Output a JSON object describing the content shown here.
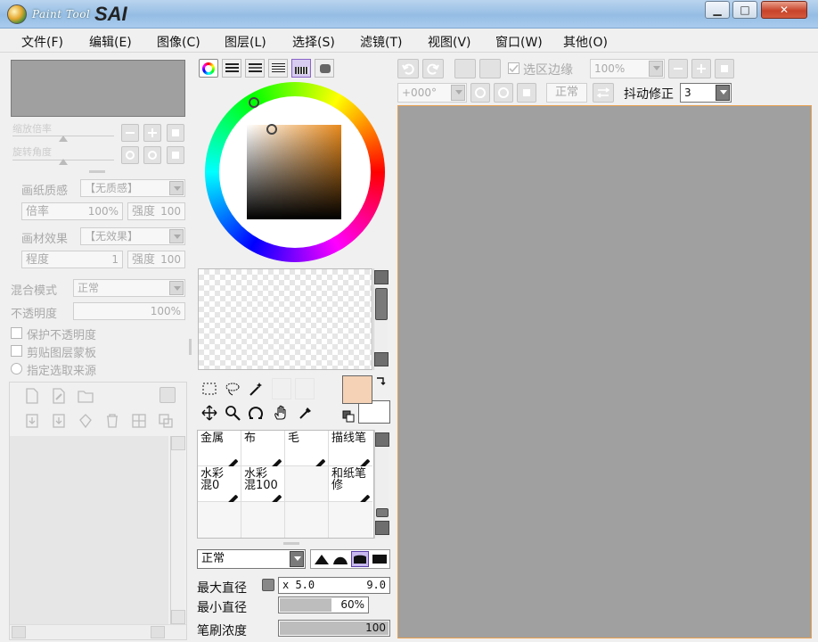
{
  "app": {
    "logo_small": "Paint Tool",
    "logo_big": "SAI"
  },
  "window_buttons": {
    "minimize": "▁",
    "maximize": "□",
    "close": "✕"
  },
  "menu": [
    "文件(F)",
    "编辑(E)",
    "图像(C)",
    "图层(L)",
    "选择(S)",
    "滤镜(T)",
    "视图(V)",
    "窗口(W)",
    "其他(O)"
  ],
  "navigator": {
    "zoom_label": "缩放倍率",
    "rotate_label": "旋转角度"
  },
  "paper": {
    "texture_label": "画纸质感",
    "texture_value": "【无质感】",
    "scale_label": "倍率",
    "scale_value": "100%",
    "strength_label": "强度",
    "strength_value": "100",
    "effect_label": "画材效果",
    "effect_value": "【无效果】",
    "degree_label": "程度",
    "degree_value": "1",
    "strength2_label": "强度",
    "strength2_value": "100"
  },
  "layer": {
    "blend_label": "混合模式",
    "blend_value": "正常",
    "opacity_label": "不透明度",
    "opacity_value": "100%",
    "protect_opacity": "保护不透明度",
    "clip_mask": "剪贴图层蒙板",
    "selection_source": "指定选取来源"
  },
  "toolbar_top": {
    "selection_edge": "选区边缘",
    "zoom_value": "100%",
    "angle_value": "+000°",
    "mode_value": "正常",
    "stabilizer_label": "抖动修正",
    "stabilizer_value": "3"
  },
  "brushes": [
    {
      "name": "金属"
    },
    {
      "name": "布"
    },
    {
      "name": "毛"
    },
    {
      "name": "描线笔"
    },
    {
      "name": "水彩\n混0"
    },
    {
      "name": "水彩\n混100"
    },
    {
      "name": ""
    },
    {
      "name": "和纸笔\n修"
    }
  ],
  "brush_settings": {
    "mode_value": "正常",
    "max_diameter_label": "最大直径",
    "max_diameter_mult": "x 5.0",
    "max_diameter_value": "9.0",
    "min_diameter_label": "最小直径",
    "min_diameter_value": "60%",
    "min_diameter_fraction": 0.6,
    "density_label": "笔刷浓度",
    "density_value": "100",
    "density_fraction": 1.0
  },
  "colors": {
    "primary": "#f5d2b5",
    "secondary": "#ffffff",
    "hue_sv_base": "#e88a1c",
    "canvas": "#a0a0a0",
    "canvas_border": "#e8a050"
  },
  "icons": {
    "color_tab_icons": [
      "color-wheel-icon",
      "rgb-slider-icon",
      "hsv-slider-icon",
      "mixer-icon",
      "swatches-icon",
      "scratchpad-icon"
    ],
    "tool_icons": [
      "rect-select-icon",
      "lasso-icon",
      "magic-wand-icon",
      "move-icon",
      "zoom-icon",
      "rotate-icon",
      "hand-icon",
      "eyedropper-icon"
    ]
  }
}
